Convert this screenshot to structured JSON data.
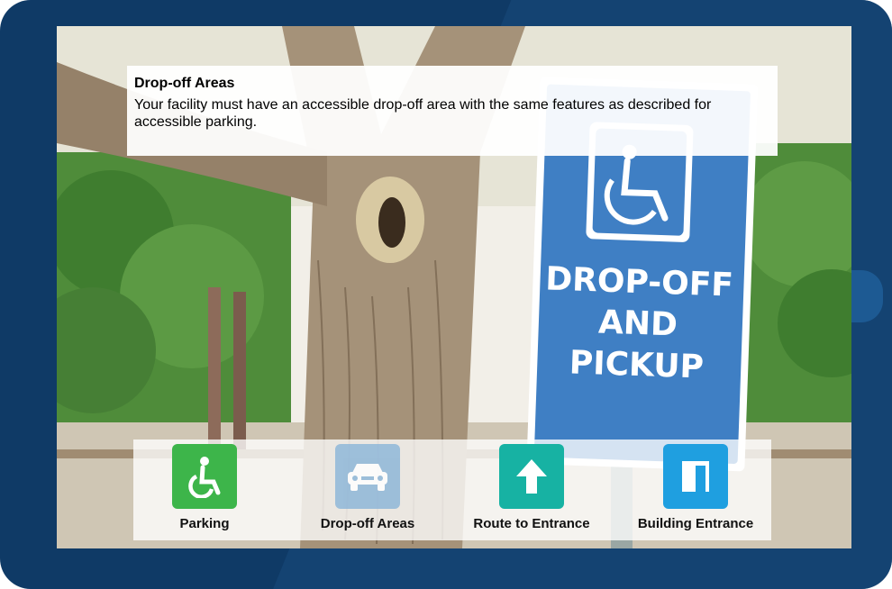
{
  "info": {
    "title": "Drop-off Areas",
    "body": "Your facility must have an accessible drop-off area with the same features as described for accessible parking."
  },
  "sign": {
    "line1": "DROP-OFF",
    "line2": "AND",
    "line3": "PICKUP"
  },
  "nav": {
    "items": [
      {
        "label": "Parking",
        "icon": "wheelchair-icon",
        "color": "#3db54a",
        "selected": false
      },
      {
        "label": "Drop-off Areas",
        "icon": "car-icon",
        "color": "#8fb7d8",
        "selected": true
      },
      {
        "label": "Route to Entrance",
        "icon": "arrow-up-icon",
        "color": "#17b2a3",
        "selected": false
      },
      {
        "label": "Building Entrance",
        "icon": "door-icon",
        "color": "#1f9fe0",
        "selected": false
      }
    ]
  },
  "colors": {
    "frame": "#0f3a66",
    "sign_blue": "#3f7fc4"
  }
}
